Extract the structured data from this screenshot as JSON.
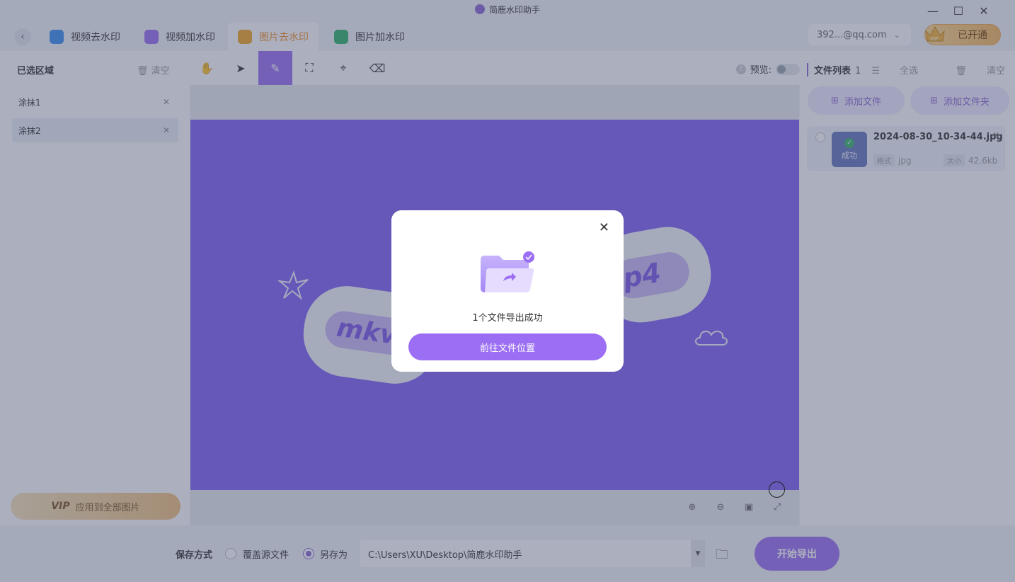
{
  "app": {
    "title": "简鹿水印助手"
  },
  "tabs": [
    {
      "label": "视频去水印",
      "icon": "video-remove-icon",
      "color": "#3a8cf0"
    },
    {
      "label": "视频加水印",
      "icon": "video-add-icon",
      "color": "#9b6ef3"
    },
    {
      "label": "图片去水印",
      "icon": "image-remove-icon",
      "color": "#f5a623",
      "active": true
    },
    {
      "label": "图片加水印",
      "icon": "image-add-icon",
      "color": "#2fb26a"
    }
  ],
  "account": {
    "email": "392...@qq.com",
    "vip_label": "已开通",
    "vip_badge": "VIP"
  },
  "left_panel": {
    "title": "已选区域",
    "clear": "清空",
    "regions": [
      {
        "label": "涂抹1"
      },
      {
        "label": "涂抹2",
        "selected": true
      }
    ],
    "apply_all_vip": "VIP",
    "apply_all": "应用到全部图片"
  },
  "toolbar": {
    "tools": [
      "hand-icon",
      "pointer-icon",
      "brush-icon",
      "rect-select-icon",
      "lasso-icon",
      "eraser-icon"
    ],
    "active_tool": "brush-icon",
    "preview_label": "预览:",
    "preview_on": false
  },
  "canvas": {
    "pill_left_text": "mkv",
    "pill_right_text": "p4"
  },
  "right_panel": {
    "title": "文件列表",
    "count": "1",
    "select_all": "全选",
    "clear": "清空",
    "add_file": "添加文件",
    "add_folder": "添加文件夹",
    "file": {
      "name": "2024-08-30_10-34-44.jpg",
      "status": "成功",
      "format_tag": "格式",
      "format": "jpg",
      "size_tag": "大小",
      "size": "42.6kb"
    }
  },
  "bottom": {
    "save_label": "保存方式",
    "overwrite": "覆盖源文件",
    "save_as": "另存为",
    "selected": "save_as",
    "path": "C:\\Users\\XU\\Desktop\\简鹿水印助手",
    "export": "开始导出"
  },
  "dialog": {
    "message": "1个文件导出成功",
    "button": "前往文件位置"
  },
  "colors": {
    "accent": "#9b6ef3",
    "canvas_bg": "#7f5ff5",
    "active_tab": "#f08a24"
  }
}
